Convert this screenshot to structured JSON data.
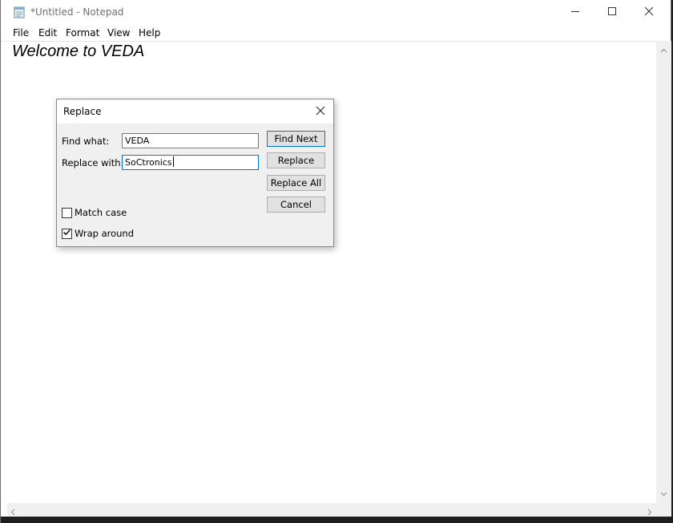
{
  "window": {
    "title": "*Untitled - Notepad",
    "icon": "notepad-icon",
    "controls": [
      "minimize-icon",
      "maximize-icon",
      "close-icon"
    ]
  },
  "menu": {
    "items": [
      {
        "label": "File"
      },
      {
        "label": "Edit"
      },
      {
        "label": "Format"
      },
      {
        "label": "View"
      },
      {
        "label": "Help"
      }
    ]
  },
  "editor": {
    "content": "Welcome to VEDA"
  },
  "dialog": {
    "title": "Replace",
    "find_label": "Find what:",
    "find_value": "VEDA",
    "replace_label": "Replace with:",
    "replace_value": "SoCtronics",
    "buttons": {
      "find_next": "Find Next",
      "replace": "Replace",
      "replace_all": "Replace All",
      "cancel": "Cancel"
    },
    "options": {
      "match_case": {
        "label": "Match case",
        "checked": false
      },
      "wrap_around": {
        "label": "Wrap around",
        "checked": true
      }
    }
  },
  "colors": {
    "accent": "#0078d7",
    "dialog_bg": "#f0f0f0",
    "title_text": "#6f6f6f"
  }
}
